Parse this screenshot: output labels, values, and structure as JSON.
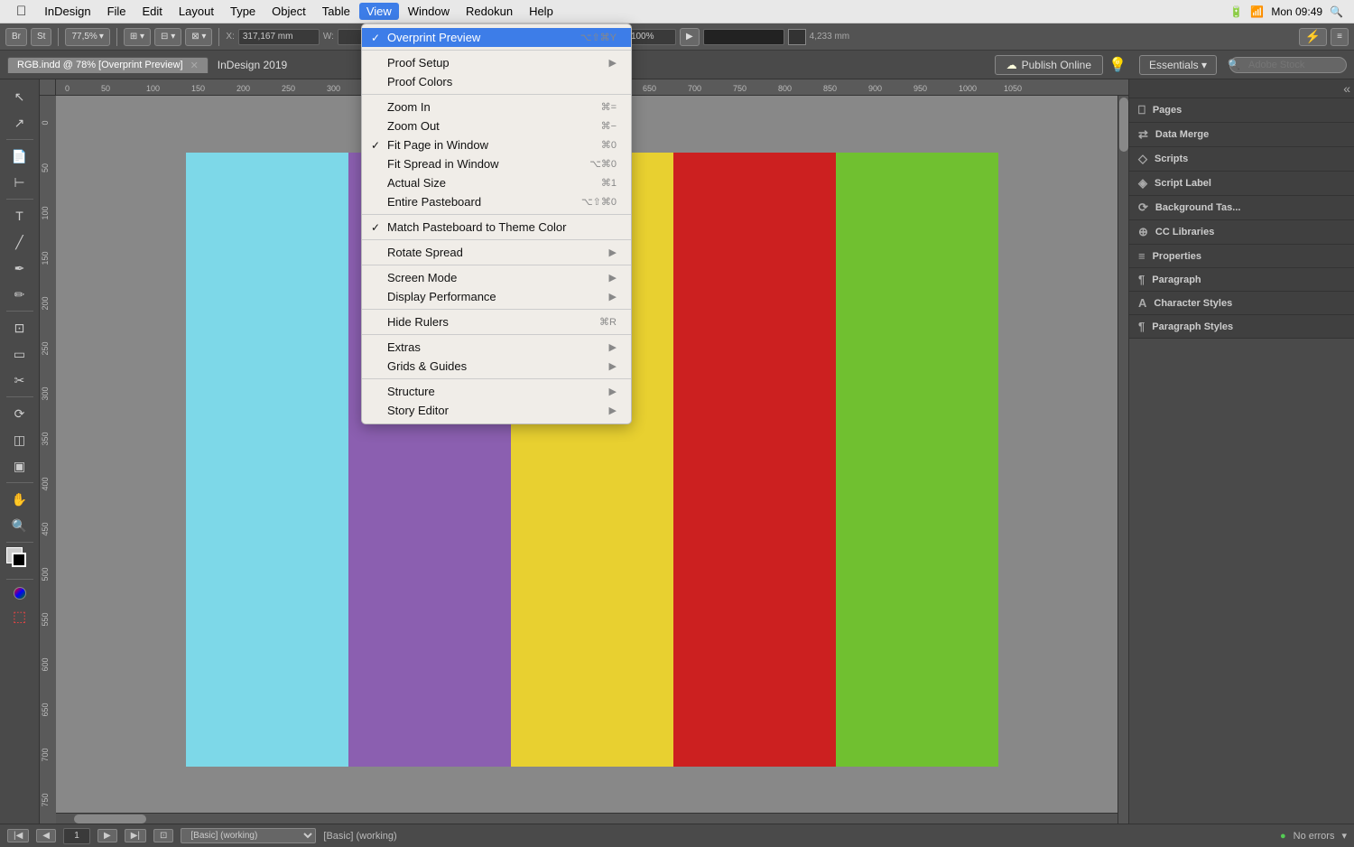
{
  "menubar": {
    "apple": "⌘",
    "items": [
      {
        "label": "InDesign",
        "active": false
      },
      {
        "label": "File",
        "active": false
      },
      {
        "label": "Edit",
        "active": false
      },
      {
        "label": "Layout",
        "active": false
      },
      {
        "label": "Type",
        "active": false
      },
      {
        "label": "Object",
        "active": false
      },
      {
        "label": "Table",
        "active": false
      },
      {
        "label": "View",
        "active": true
      },
      {
        "label": "Window",
        "active": false
      },
      {
        "label": "Redokun",
        "active": false
      },
      {
        "label": "Help",
        "active": false
      }
    ],
    "right": {
      "time": "Mon 09:49",
      "battery": "100%",
      "wifi": "WiFi"
    }
  },
  "toolbar": {
    "zoom": "77,5%",
    "fit_spread": "Fit Spread in Window",
    "fit_spread_shortcut": "⌥⌘0"
  },
  "doc": {
    "title": "InDesign 2019",
    "tab_label": "RGB.indd @ 78% [Overprint Preview]",
    "publish_btn": "Publish Online",
    "essentials": "Essentials",
    "search_placeholder": "Adobe Stock"
  },
  "view_menu": {
    "items": [
      {
        "label": "Overprint Preview",
        "shortcut": "⌥⇧⌘Y",
        "checked": true,
        "has_submenu": false,
        "separator_after": false
      },
      {
        "label": "Proof Setup",
        "shortcut": "",
        "checked": false,
        "has_submenu": true,
        "separator_after": false
      },
      {
        "label": "Proof Colors",
        "shortcut": "",
        "checked": false,
        "has_submenu": false,
        "separator_after": true
      },
      {
        "label": "Zoom In",
        "shortcut": "⌘=",
        "checked": false,
        "has_submenu": false,
        "separator_after": false
      },
      {
        "label": "Zoom Out",
        "shortcut": "⌘-",
        "checked": false,
        "has_submenu": false,
        "separator_after": false
      },
      {
        "label": "Fit Page in Window",
        "shortcut": "⌘0",
        "checked": true,
        "has_submenu": false,
        "separator_after": false
      },
      {
        "label": "Fit Spread in Window",
        "shortcut": "⌥⌘0",
        "checked": false,
        "has_submenu": false,
        "separator_after": false
      },
      {
        "label": "Actual Size",
        "shortcut": "⌘1",
        "checked": false,
        "has_submenu": false,
        "separator_after": false
      },
      {
        "label": "Entire Pasteboard",
        "shortcut": "⌥⇧⌘0",
        "checked": false,
        "has_submenu": false,
        "separator_after": true
      },
      {
        "label": "Match Pasteboard to Theme Color",
        "shortcut": "",
        "checked": true,
        "has_submenu": false,
        "separator_after": true
      },
      {
        "label": "Rotate Spread",
        "shortcut": "",
        "checked": false,
        "has_submenu": true,
        "separator_after": false
      },
      {
        "label": "Screen Mode",
        "shortcut": "",
        "checked": false,
        "has_submenu": true,
        "separator_after": false
      },
      {
        "label": "Display Performance",
        "shortcut": "",
        "checked": false,
        "has_submenu": true,
        "separator_after": true
      },
      {
        "label": "Hide Rulers",
        "shortcut": "⌘R",
        "checked": false,
        "has_submenu": false,
        "separator_after": true
      },
      {
        "label": "Extras",
        "shortcut": "",
        "checked": false,
        "has_submenu": true,
        "separator_after": false
      },
      {
        "label": "Grids & Guides",
        "shortcut": "",
        "checked": false,
        "has_submenu": true,
        "separator_after": true
      },
      {
        "label": "Structure",
        "shortcut": "",
        "checked": false,
        "has_submenu": true,
        "separator_after": false
      },
      {
        "label": "Story Editor",
        "shortcut": "",
        "checked": false,
        "has_submenu": true,
        "separator_after": false
      }
    ]
  },
  "right_panel": {
    "items": [
      {
        "label": "Pages",
        "icon": "📄"
      },
      {
        "label": "Data Merge",
        "icon": "⇄"
      },
      {
        "label": "Scripts",
        "icon": "◇"
      },
      {
        "label": "Script Label",
        "icon": "◈"
      },
      {
        "label": "Background Tas...",
        "icon": "⟳"
      },
      {
        "label": "CC Libraries",
        "icon": "⊕"
      },
      {
        "label": "Properties",
        "icon": "≡"
      },
      {
        "label": "Paragraph",
        "icon": "¶"
      },
      {
        "label": "Character Styles",
        "icon": "A"
      },
      {
        "label": "Paragraph Styles",
        "icon": "¶"
      }
    ]
  },
  "colors": {
    "cyan": "#7dd8e8",
    "purple": "#8b5fb0",
    "yellow": "#e8d030",
    "red": "#cc2020",
    "green": "#70c030",
    "bg_grey": "#888888",
    "menu_highlight": "#3d7de8"
  },
  "status_bar": {
    "page": "1",
    "working": "[Basic] (working)",
    "errors": "No errors"
  }
}
